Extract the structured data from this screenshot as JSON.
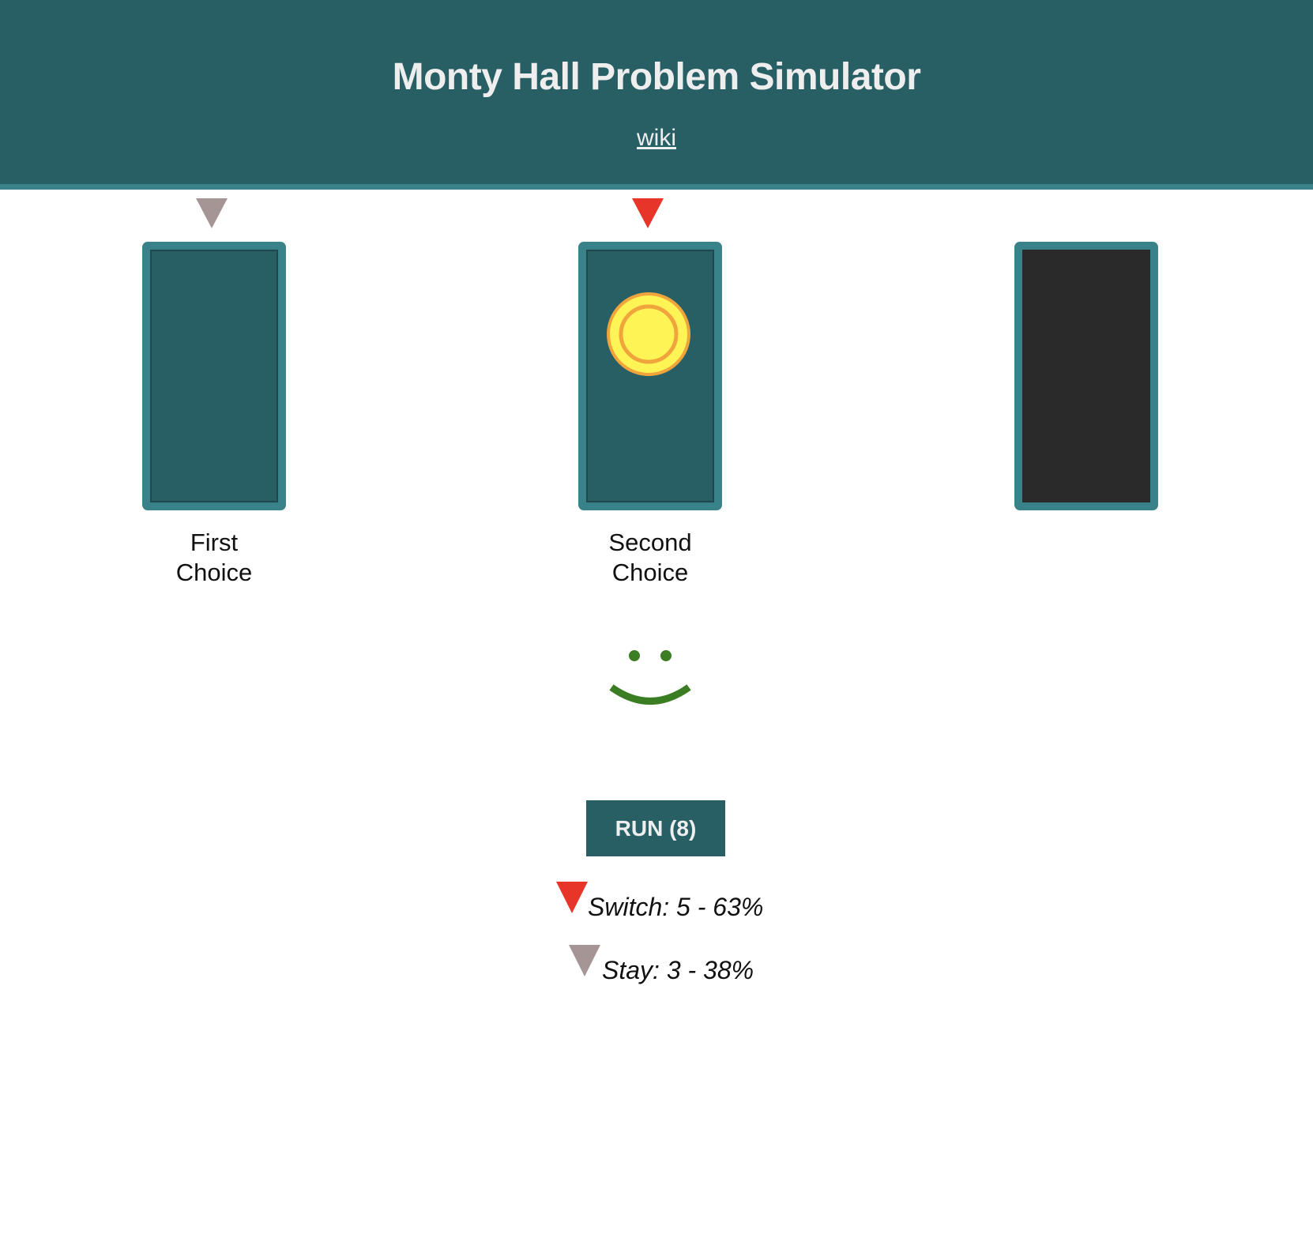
{
  "header": {
    "title": "Monty Hall Problem Simulator",
    "wiki_link": "wiki"
  },
  "colors": {
    "header_bg": "#285f65",
    "header_border": "#3a828a",
    "door_closed": "#285f65",
    "door_open": "#2a2a2a",
    "first_choice_marker": "#a69595",
    "second_choice_marker": "#e8352a",
    "coin": "#fff456",
    "coin_ring": "#f0a53c",
    "smiley": "#3a7d22",
    "button_bg": "#285f65"
  },
  "doors": [
    {
      "state": "closed",
      "marker": "first-choice",
      "prize": false,
      "label_line1": "First",
      "label_line2": "Choice"
    },
    {
      "state": "closed",
      "marker": "second-choice",
      "prize": true,
      "label_line1": "Second",
      "label_line2": "Choice"
    },
    {
      "state": "open",
      "marker": "none",
      "prize": false,
      "label_line1": "",
      "label_line2": ""
    }
  ],
  "result": {
    "icon": "smiley-face-icon",
    "outcome": "win"
  },
  "controls": {
    "run_label": "RUN (8)"
  },
  "stats": {
    "switch": {
      "text": "Switch: 5 - 63%",
      "wins": 5,
      "percent": 63
    },
    "stay": {
      "text": "Stay: 3 - 38%",
      "wins": 3,
      "percent": 38
    }
  }
}
